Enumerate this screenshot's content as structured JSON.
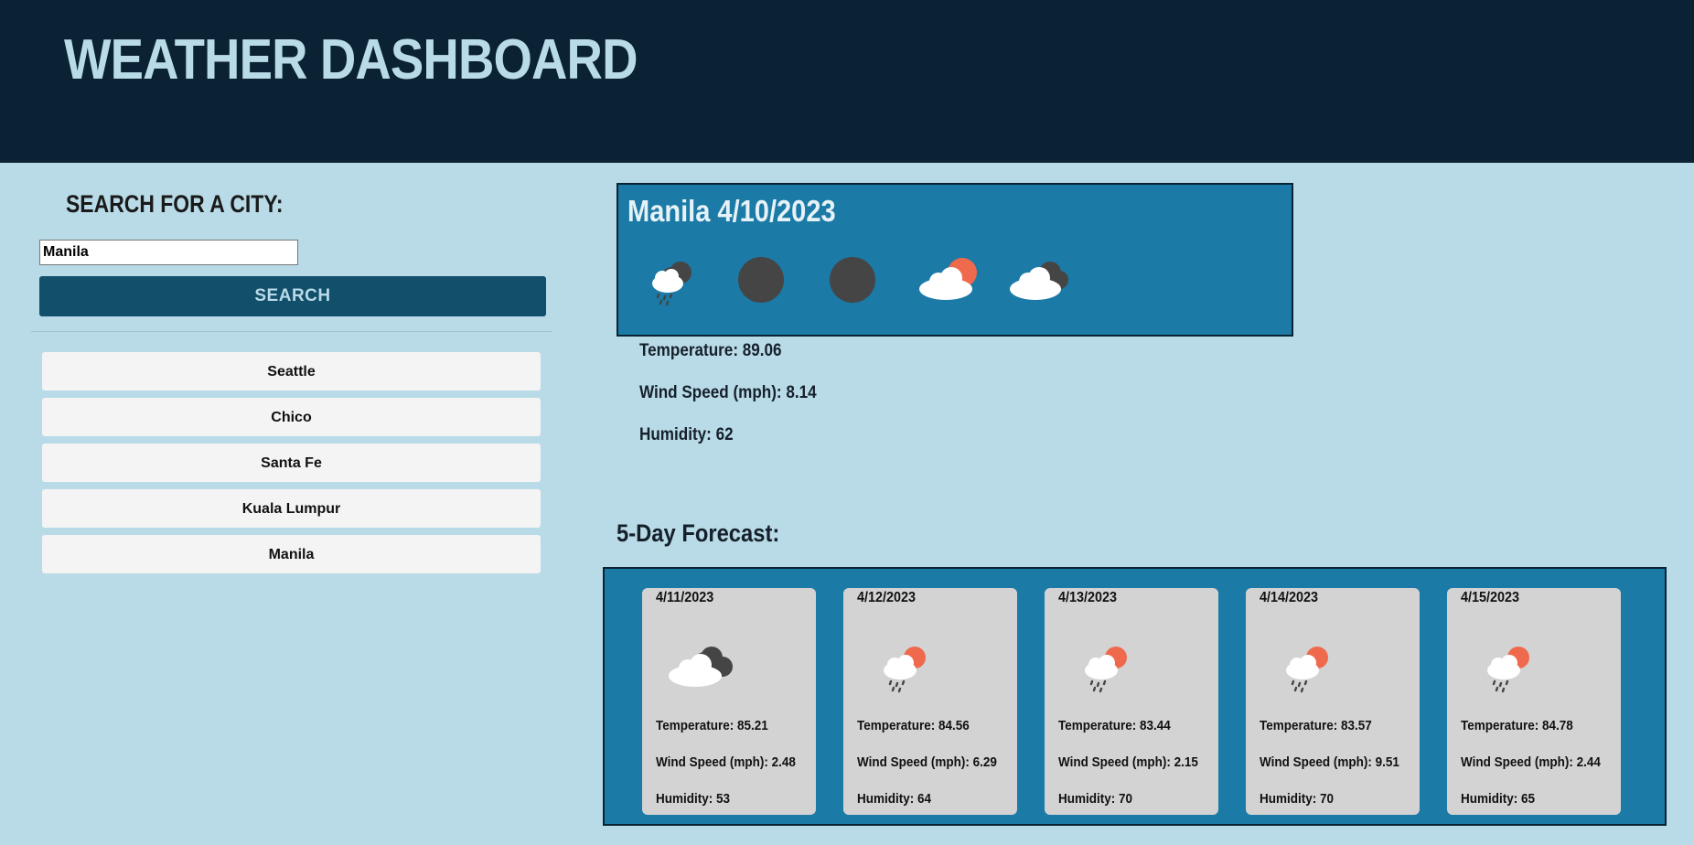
{
  "header": {
    "title": "WEATHER DASHBOARD"
  },
  "sidebar": {
    "title": "SEARCH FOR A CITY:",
    "search_value": "Manila",
    "search_button": "SEARCH",
    "history": [
      "Seattle",
      "Chico",
      "Santa Fe",
      "Kuala Lumpur",
      "Manila"
    ]
  },
  "current": {
    "title": "Manila 4/10/2023",
    "icons": [
      "rain-cloud-icon",
      "dark-circle-icon",
      "dark-circle-icon",
      "cloud-sun-icon",
      "cloud-dark-icon"
    ],
    "temperature": "Temperature: 89.06",
    "wind": "Wind Speed (mph): 8.14",
    "humidity": "Humidity: 62"
  },
  "forecast": {
    "title": "5-Day Forecast:",
    "days": [
      {
        "date": "4/11/2023",
        "icon": "cloud-dark-icon",
        "temperature": "Temperature: 85.21",
        "wind": "Wind Speed (mph): 2.48",
        "humidity": "Humidity: 53"
      },
      {
        "date": "4/12/2023",
        "icon": "rain-sun-icon",
        "temperature": "Temperature: 84.56",
        "wind": "Wind Speed (mph): 6.29",
        "humidity": "Humidity: 64"
      },
      {
        "date": "4/13/2023",
        "icon": "rain-sun-icon",
        "temperature": "Temperature: 83.44",
        "wind": "Wind Speed (mph): 2.15",
        "humidity": "Humidity: 70"
      },
      {
        "date": "4/14/2023",
        "icon": "rain-sun-icon",
        "temperature": "Temperature: 83.57",
        "wind": "Wind Speed (mph): 9.51",
        "humidity": "Humidity: 70"
      },
      {
        "date": "4/15/2023",
        "icon": "rain-sun-icon",
        "temperature": "Temperature: 84.78",
        "wind": "Wind Speed (mph): 2.44",
        "humidity": "Humidity: 65"
      }
    ]
  },
  "colors": {
    "header_bg": "#0a2233",
    "page_bg": "#b9dbe7",
    "accent": "#1b7aa6",
    "button_bg": "#124f6b",
    "sun": "#ef6a4c",
    "dark_cloud": "#454545"
  }
}
